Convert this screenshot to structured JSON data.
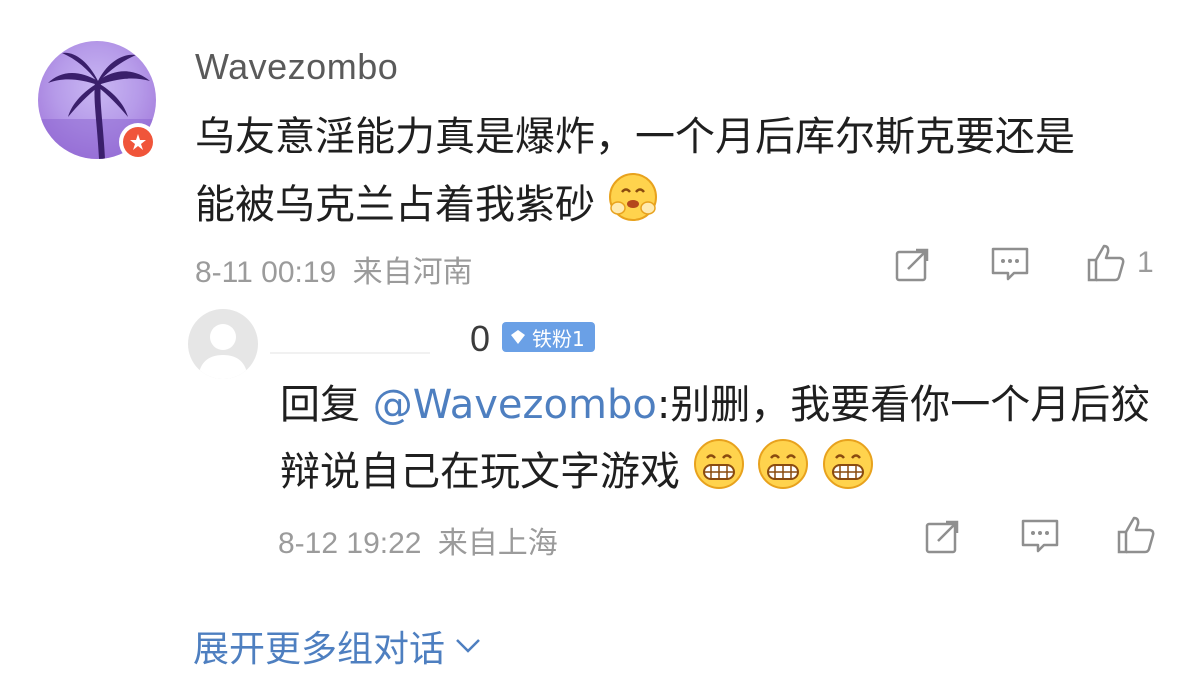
{
  "comment": {
    "username": "Wavezombo",
    "text_line1": "乌友意淫能力真是爆炸，一个月后库尔斯克要还是",
    "text_line2": "能被乌克兰占着我紫砂",
    "timestamp": "8-11 00:19",
    "location": "来自河南",
    "like_count": "1",
    "icons": [
      "share-icon",
      "comment-icon",
      "like-icon"
    ]
  },
  "reply": {
    "name_suffix": "0",
    "fan_badge": "铁粉1",
    "prefix": "回复 ",
    "mention": "@Wavezombo",
    "text_line1_rest": ":别删，我要看你一个月后狡",
    "text_line2": "辩说自己在玩文字游戏",
    "timestamp": "8-12 19:22",
    "location": "来自上海"
  },
  "expand_label": "展开更多组对话",
  "colors": {
    "link": "#4e7fc0",
    "meta": "#9b9b9b",
    "badge_red": "#f0553a",
    "fan_badge": "#6aa0e6"
  }
}
